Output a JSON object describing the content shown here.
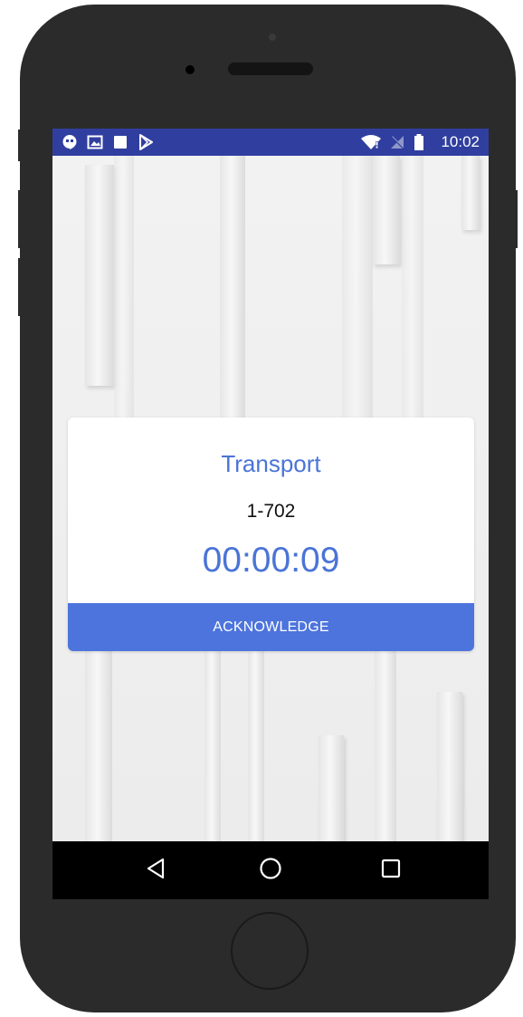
{
  "statusbar": {
    "time": "10:02",
    "left_icons": [
      "hangouts-icon",
      "image-icon",
      "square-notification-icon",
      "play-store-icon"
    ],
    "right_icons": [
      "wifi-icon",
      "no-sim-icon",
      "battery-icon"
    ]
  },
  "card": {
    "title": "Transport",
    "number": "1-702",
    "timer": "00:00:09",
    "acknowledge_label": "ACKNOWLEDGE"
  },
  "navbar": {
    "buttons": [
      "back-icon",
      "home-icon",
      "recents-icon"
    ]
  },
  "colors": {
    "statusbar": "#303f9f",
    "accent": "#4a74d6",
    "button": "#4d74dc",
    "phone_body": "#2b2b2b"
  }
}
